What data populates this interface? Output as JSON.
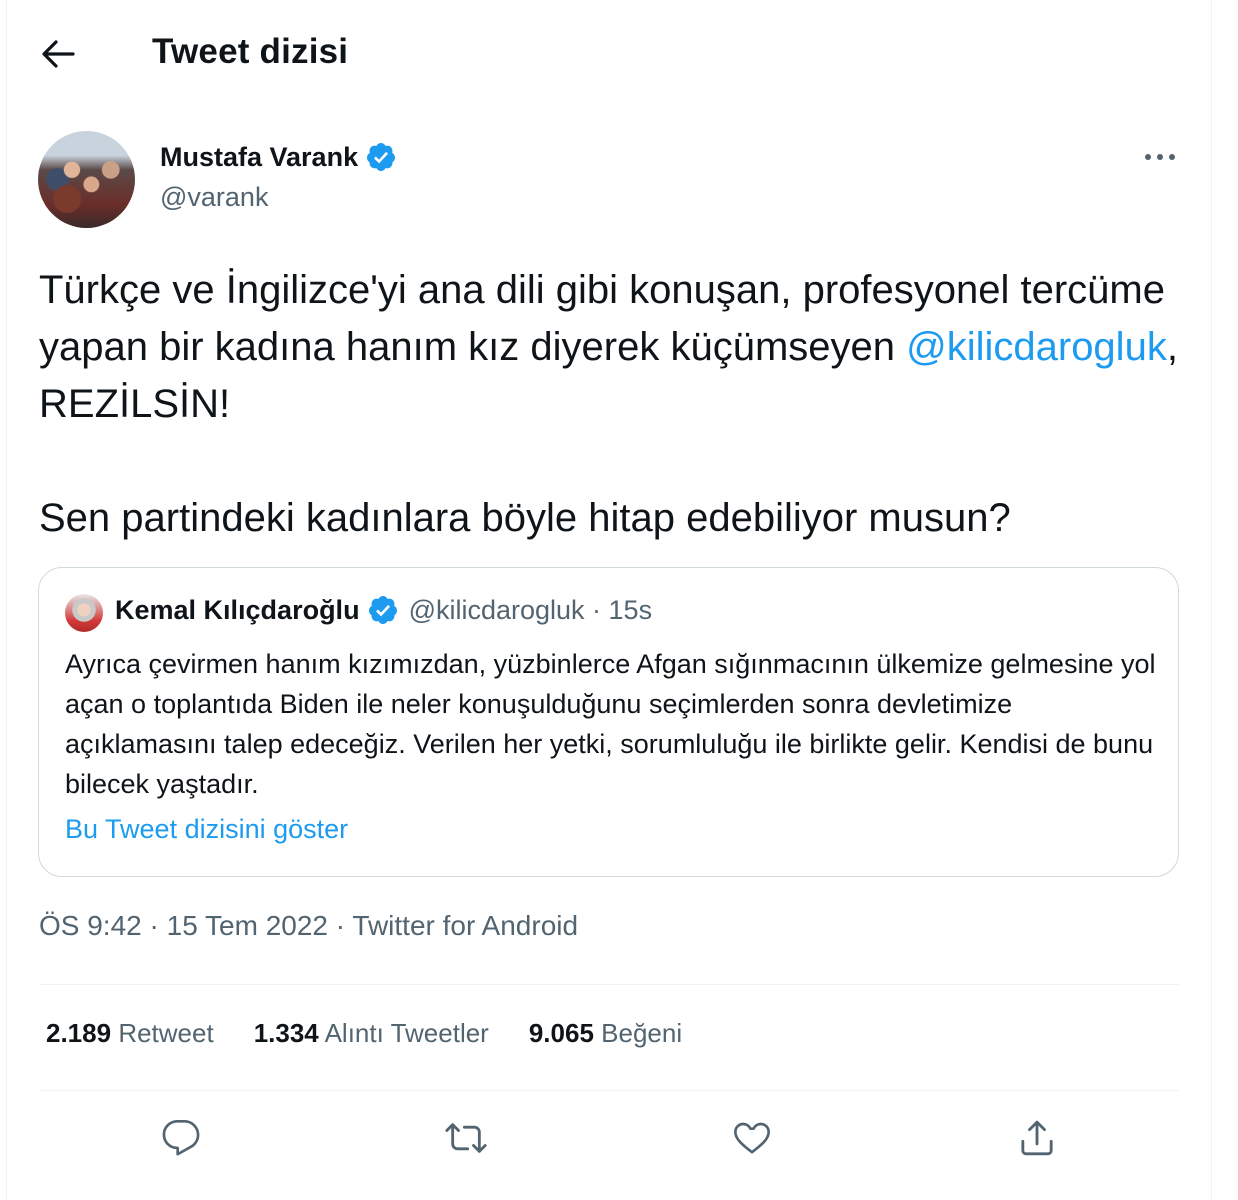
{
  "header": {
    "back_icon": "arrow-left-icon",
    "title": "Tweet dizisi"
  },
  "tweet": {
    "author": {
      "name": "Mustafa Varank",
      "handle": "@varank",
      "verified_icon": "verified-badge-icon"
    },
    "more_icon": "more-horizontal-icon",
    "text": {
      "line_part1": "Türkçe ve İngilizce'yi ana dili gibi konuşan, profesyonel tercüme yapan bir kadına hanım kız diyerek küçümseyen ",
      "mention": "@kilicdarogluk",
      "line_part2": ", REZİLSİN!",
      "paragraph2": "Sen partindeki kadınlara böyle hitap edebiliyor musun?"
    },
    "quote": {
      "name": "Kemal Kılıçdaroğlu",
      "meta": "@kilicdarogluk · 15s",
      "text": "Ayrıca çevirmen hanım kızımızdan, yüzbinlerce Afgan sığınmacının ülkemize gelmesine yol açan o toplantıda Biden ile neler konuşulduğunu seçimlerden sonra devletimize açıklamasını talep edeceğiz. Verilen her yetki, sorumluluğu ile birlikte gelir. Kendisi de bunu bilecek yaştadır.",
      "show_thread": "Bu Tweet dizisini göster"
    },
    "timestamp": {
      "time": "ÖS 9:42",
      "date": "15 Tem 2022",
      "source": "Twitter for Android",
      "separator": " · "
    },
    "stats": {
      "retweets": {
        "count": "2.189",
        "label": "Retweet"
      },
      "quotes": {
        "count": "1.334",
        "label": "Alıntı Tweetler"
      },
      "likes": {
        "count": "9.065",
        "label": "Beğeni"
      }
    },
    "actions": [
      "reply-icon",
      "retweet-icon",
      "like-icon",
      "share-icon"
    ]
  },
  "colors": {
    "accent": "#1d9bf0",
    "text_primary": "#0f1419",
    "text_secondary": "#536471",
    "border": "#cfd9de"
  }
}
